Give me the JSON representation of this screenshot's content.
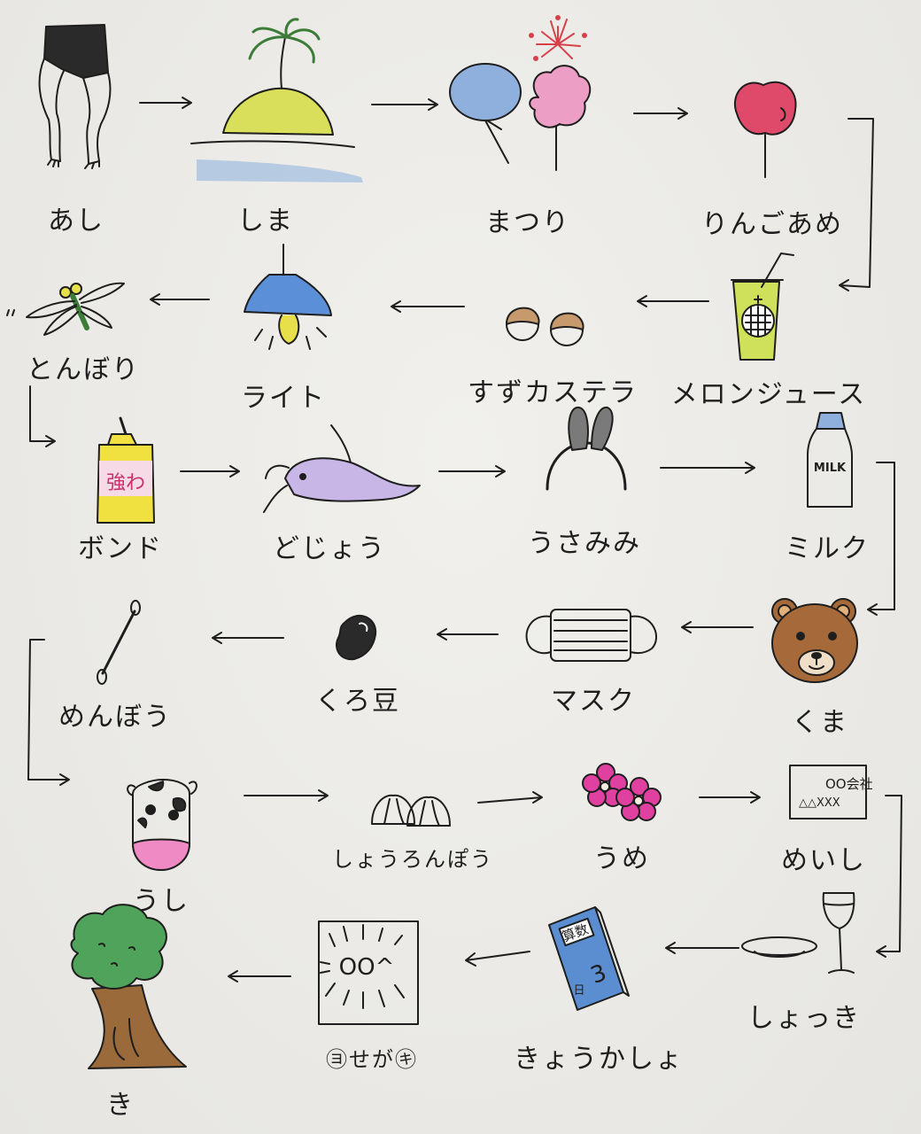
{
  "labels": {
    "ashi": "あし",
    "shima": "しま",
    "matsuri": "まつり",
    "ringoame": "りんごあめ",
    "tonbori": "とんぼり",
    "raito": "ライト",
    "suzukasutera": "すずカステラ",
    "meronjuusu": "メロンジュース",
    "bondo": "ボンド",
    "dojou": "どじょう",
    "usamimi": "うさみみ",
    "miruku": "ミルク",
    "menbou": "めんぼう",
    "kuromame": "くろ豆",
    "masuku": "マスク",
    "kuma": "くま",
    "ushi": "うし",
    "shouronpou": "しょうろんぽう",
    "ume": "うめ",
    "meishi": "めいし",
    "ki": "き",
    "yosegaki": "㋵せが㋖",
    "kyoukasho": "きょうかしょ",
    "shokki": "しょっき"
  },
  "drawn_text": {
    "bond_tube": "強わ",
    "milk_bottle": "MILK",
    "card_line1": "OO会社",
    "card_line2": "△△XXX",
    "yosegaki_center": "OO^",
    "book_title": "算数",
    "book_number": "3",
    "book_circle": "日"
  },
  "colors": {
    "ink": "#1e1e1e",
    "island_top": "#d9df5a",
    "sea": "#a9c3e0",
    "palm": "#4f9a4a",
    "fan": "#8fb0dd",
    "candy_floss": "#ec9ec4",
    "apple": "#e04a6a",
    "juice": "#cfe05a",
    "lamp": "#5b8fd8",
    "bulb": "#e8e04a",
    "bond": "#f0e040",
    "loach": "#c8b6e6",
    "bear": "#a66a3a",
    "cow_pink": "#ef8ac4",
    "ume_pink": "#e040a0",
    "tree_leaves": "#4fa35a",
    "tree_trunk": "#9b6a3a",
    "book": "#5a8ed0"
  }
}
